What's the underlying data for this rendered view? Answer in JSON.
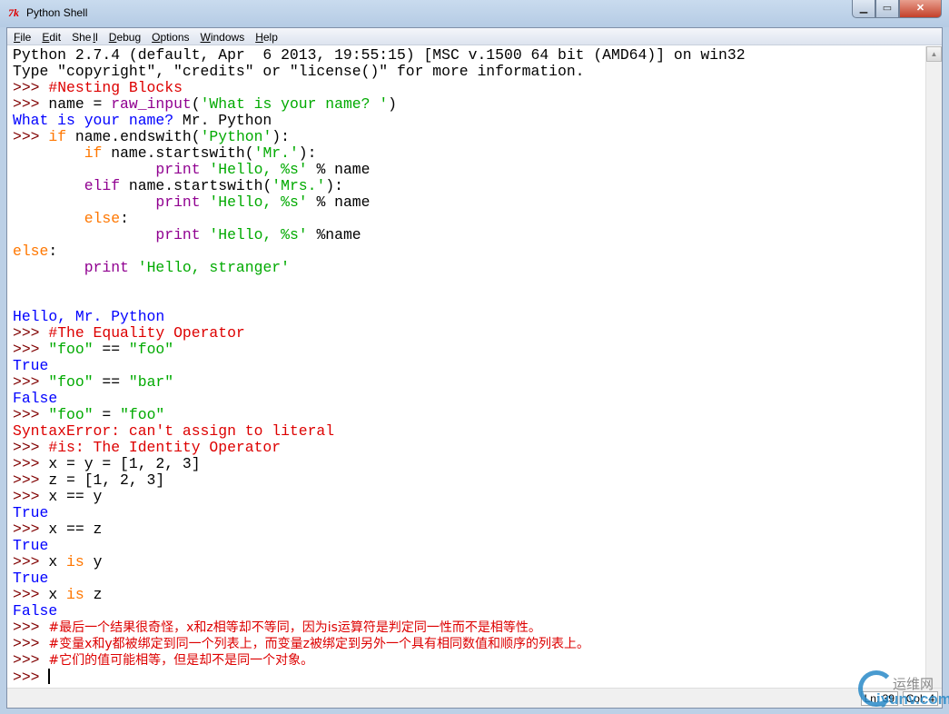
{
  "window": {
    "title": "Python Shell",
    "icon": "tk-icon",
    "minimize": "▁",
    "maximize": "▭",
    "close": "✕"
  },
  "menu": [
    {
      "u": "F",
      "rest": "ile"
    },
    {
      "u": "E",
      "rest": "dit"
    },
    {
      "pre": "She",
      "u": "l",
      "rest": "l"
    },
    {
      "u": "D",
      "rest": "ebug"
    },
    {
      "u": "O",
      "rest": "ptions"
    },
    {
      "u": "W",
      "rest": "indows"
    },
    {
      "u": "H",
      "rest": "elp"
    }
  ],
  "lines": [
    [
      [
        "Python 2.7.4 (default, Apr  6 2013, 19:55:15) [MSC v.1500 64 bit (AMD64)] on win32",
        "plain"
      ]
    ],
    [
      [
        "Type \"copyright\", \"credits\" or \"license()\" for more information.",
        "plain"
      ]
    ],
    [
      [
        ">>> ",
        "prompt"
      ],
      [
        "#Nesting Blocks",
        "comment"
      ]
    ],
    [
      [
        ">>> ",
        "prompt"
      ],
      [
        "name = ",
        "plain"
      ],
      [
        "raw_input",
        "builtin"
      ],
      [
        "(",
        "plain"
      ],
      [
        "'What is your name? '",
        "string"
      ],
      [
        ")",
        "plain"
      ]
    ],
    [
      [
        "What is your name? ",
        "out"
      ],
      [
        "Mr. Python",
        "plain"
      ]
    ],
    [
      [
        ">>> ",
        "prompt"
      ],
      [
        "if",
        "kw"
      ],
      [
        " name.endswith(",
        "plain"
      ],
      [
        "'Python'",
        "string"
      ],
      [
        "):",
        "plain"
      ]
    ],
    [
      [
        "        ",
        "plain"
      ],
      [
        "if",
        "kw"
      ],
      [
        " name.startswith(",
        "plain"
      ],
      [
        "'Mr.'",
        "string"
      ],
      [
        "):",
        "plain"
      ]
    ],
    [
      [
        "                ",
        "plain"
      ],
      [
        "print",
        "builtin"
      ],
      [
        " ",
        "plain"
      ],
      [
        "'Hello, %s'",
        "string"
      ],
      [
        " % name",
        "plain"
      ]
    ],
    [
      [
        "        ",
        "plain"
      ],
      [
        "elif",
        "builtin"
      ],
      [
        " name.startswith(",
        "plain"
      ],
      [
        "'Mrs.'",
        "string"
      ],
      [
        "):",
        "plain"
      ]
    ],
    [
      [
        "                ",
        "plain"
      ],
      [
        "print",
        "builtin"
      ],
      [
        " ",
        "plain"
      ],
      [
        "'Hello, %s'",
        "string"
      ],
      [
        " % name",
        "plain"
      ]
    ],
    [
      [
        "        ",
        "plain"
      ],
      [
        "else",
        "kw"
      ],
      [
        ":",
        "plain"
      ]
    ],
    [
      [
        "                ",
        "plain"
      ],
      [
        "print",
        "builtin"
      ],
      [
        " ",
        "plain"
      ],
      [
        "'Hello, %s'",
        "string"
      ],
      [
        " %name",
        "plain"
      ]
    ],
    [
      [
        "else",
        "kw"
      ],
      [
        ":",
        "plain"
      ]
    ],
    [
      [
        "        ",
        "plain"
      ],
      [
        "print",
        "builtin"
      ],
      [
        " ",
        "plain"
      ],
      [
        "'Hello, stranger'",
        "string"
      ]
    ],
    [],
    [],
    [
      [
        "Hello, Mr. Python",
        "out"
      ]
    ],
    [
      [
        ">>> ",
        "prompt"
      ],
      [
        "#The Equality Operator",
        "comment"
      ]
    ],
    [
      [
        ">>> ",
        "prompt"
      ],
      [
        "\"foo\"",
        "string"
      ],
      [
        " == ",
        "plain"
      ],
      [
        "\"foo\"",
        "string"
      ]
    ],
    [
      [
        "True",
        "out"
      ]
    ],
    [
      [
        ">>> ",
        "prompt"
      ],
      [
        "\"foo\"",
        "string"
      ],
      [
        " == ",
        "plain"
      ],
      [
        "\"bar\"",
        "string"
      ]
    ],
    [
      [
        "False",
        "out"
      ]
    ],
    [
      [
        ">>> ",
        "prompt"
      ],
      [
        "\"foo\"",
        "string"
      ],
      [
        " = ",
        "plain"
      ],
      [
        "\"foo\"",
        "string"
      ]
    ],
    [
      [
        "SyntaxError: can't assign to literal",
        "err"
      ]
    ],
    [
      [
        ">>> ",
        "prompt"
      ],
      [
        "#is: The Identity Operator",
        "comment"
      ]
    ],
    [
      [
        ">>> ",
        "prompt"
      ],
      [
        "x = y = [1, 2, 3]",
        "plain"
      ]
    ],
    [
      [
        ">>> ",
        "prompt"
      ],
      [
        "z = [1, 2, 3]",
        "plain"
      ]
    ],
    [
      [
        ">>> ",
        "prompt"
      ],
      [
        "x == y",
        "plain"
      ]
    ],
    [
      [
        "True",
        "out"
      ]
    ],
    [
      [
        ">>> ",
        "prompt"
      ],
      [
        "x == z",
        "plain"
      ]
    ],
    [
      [
        "True",
        "out"
      ]
    ],
    [
      [
        ">>> ",
        "prompt"
      ],
      [
        "x ",
        "plain"
      ],
      [
        "is",
        "kw"
      ],
      [
        " y",
        "plain"
      ]
    ],
    [
      [
        "True",
        "out"
      ]
    ],
    [
      [
        ">>> ",
        "prompt"
      ],
      [
        "x ",
        "plain"
      ],
      [
        "is",
        "kw"
      ],
      [
        " z",
        "plain"
      ]
    ],
    [
      [
        "False",
        "out"
      ]
    ],
    [
      [
        ">>> ",
        "prompt"
      ],
      [
        "#最后一个结果很奇怪，x和z相等却不等同，因为is运算符是判定同一性而不是相等性。",
        "comment cjk"
      ]
    ],
    [
      [
        ">>> ",
        "prompt"
      ],
      [
        "#变量x和y都被绑定到同一个列表上，而变量z被绑定到另外一个具有相同数值和顺序的列表上。",
        "comment cjk"
      ]
    ],
    [
      [
        ">>> ",
        "prompt"
      ],
      [
        "#它们的值可能相等，但是却不是同一个对象。",
        "comment cjk"
      ]
    ],
    [
      [
        ">>> ",
        "prompt"
      ]
    ]
  ],
  "status": {
    "ln": "Ln: 39",
    "col": "Col: 4"
  },
  "watermark": {
    "cn": "运维网",
    "en": "iyunv.com"
  }
}
